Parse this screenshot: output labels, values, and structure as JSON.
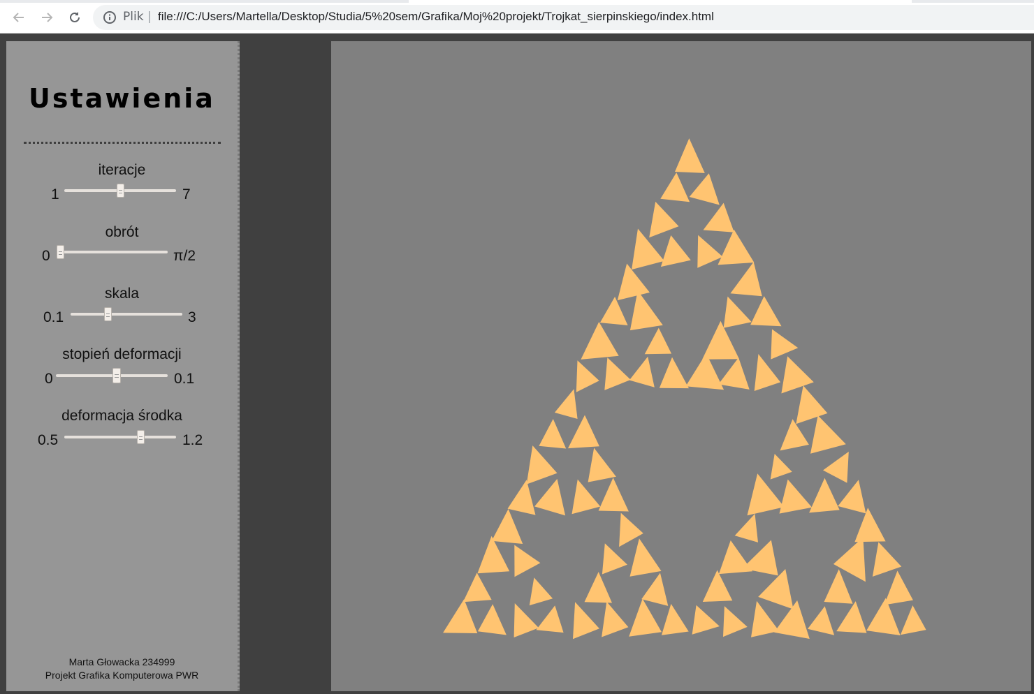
{
  "browser": {
    "scheme_label": "Plik",
    "separator": "|",
    "url": "file:///C:/Users/Martella/Desktop/Studia/5%20sem/Grafika/Moj%20projekt/Trojkat_sierpinskiego/index.html"
  },
  "sidebar": {
    "title": "Ustawienia",
    "controls": [
      {
        "label": "iteracje",
        "min": "1",
        "max": "7",
        "value_fraction": 0.5
      },
      {
        "label": "obrót",
        "min": "0",
        "max": "π/2",
        "value_fraction": 0.0
      },
      {
        "label": "skala",
        "min": "0.1",
        "max": "3",
        "value_fraction": 0.32
      },
      {
        "label": "stopień deformacji",
        "min": "0",
        "max": "0.1",
        "value_fraction": 0.55
      },
      {
        "label": "deformacja środka",
        "min": "0.5",
        "max": "1.2",
        "value_fraction": 0.7
      }
    ],
    "footer_line1": "Marta Głowacka 234999",
    "footer_line2": "Projekt Grafika Komputerowa PWR"
  },
  "colors": {
    "triangle_fill": "#ffc471",
    "canvas_bg": "#808080",
    "sidebar_bg": "#969696",
    "page_bg": "#404040"
  }
}
